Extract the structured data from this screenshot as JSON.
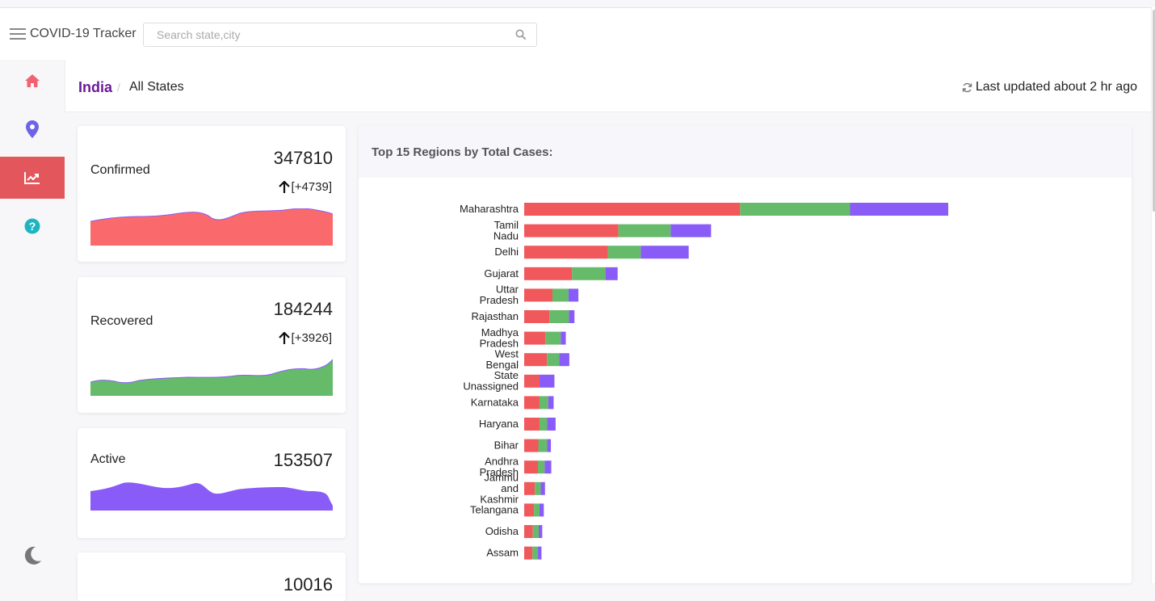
{
  "header": {
    "app_title": "COVID-19 Tracker",
    "search_placeholder": "Search state,city"
  },
  "breadcrumb": {
    "country": "India",
    "separator": "/",
    "current": "All States"
  },
  "last_updated": "Last updated about 2 hr ago",
  "sidebar": {
    "items": [
      {
        "icon": "home-icon",
        "color": "#f0636e"
      },
      {
        "icon": "map-pin-icon",
        "color": "#6c63e8"
      },
      {
        "icon": "trending-chart-icon",
        "color": "#ffffff",
        "active": true
      },
      {
        "icon": "help-icon",
        "color": "#1fb5c0"
      }
    ],
    "theme_toggle_icon": "moon-icon"
  },
  "cards": [
    {
      "label": "Confirmed",
      "value": "347810",
      "delta": "[+4739]",
      "color": "#f56467"
    },
    {
      "label": "Recovered",
      "value": "184244",
      "delta": "[+3926]",
      "color": "#5cb85c"
    },
    {
      "label": "Active",
      "value": "153507",
      "delta": "",
      "color": "#8a5cf7"
    },
    {
      "label": "",
      "value": "10016",
      "delta": "",
      "color": "#888888"
    }
  ],
  "colors": {
    "confirmed": "#f0585c",
    "recovered": "#66bb6a",
    "active": "#8a5cf7",
    "brand": "#6a1b9a",
    "active_nav": "#e3575c"
  },
  "chart_data": {
    "type": "bar",
    "orientation": "horizontal",
    "stacked": true,
    "title": "Top 15 Regions by Total Cases:",
    "categories": [
      [
        "Maharashtra"
      ],
      [
        "Tamil",
        "Nadu"
      ],
      [
        "Delhi"
      ],
      [
        "Gujarat"
      ],
      [
        "Uttar",
        "Pradesh"
      ],
      [
        "Rajasthan"
      ],
      [
        "Madhya",
        "Pradesh"
      ],
      [
        "West",
        "Bengal"
      ],
      [
        "State",
        "Unassigned"
      ],
      [
        "Karnataka"
      ],
      [
        "Haryana"
      ],
      [
        "Bihar"
      ],
      [
        "Andhra",
        "Pradesh"
      ],
      [
        "Jammu",
        "and",
        "Kashmir"
      ],
      [
        "Telangana"
      ],
      [
        "Odisha"
      ],
      [
        "Assam"
      ]
    ],
    "series": [
      {
        "values": [
          55000,
          24000,
          21300,
          12200,
          7200,
          6400,
          5400,
          5800,
          3900,
          3900,
          3900,
          3600,
          3500,
          2700,
          2500,
          2200,
          2100
        ]
      },
      {
        "values": [
          28000,
          13300,
          8400,
          8500,
          4100,
          5000,
          3900,
          3100,
          0,
          2200,
          1900,
          2200,
          1700,
          1500,
          1400,
          1500,
          1400
        ]
      },
      {
        "values": [
          25000,
          10300,
          12200,
          3100,
          2500,
          1400,
          1300,
          2600,
          3800,
          1400,
          2200,
          1000,
          1700,
          1100,
          1100,
          900,
          900
        ]
      }
    ]
  }
}
